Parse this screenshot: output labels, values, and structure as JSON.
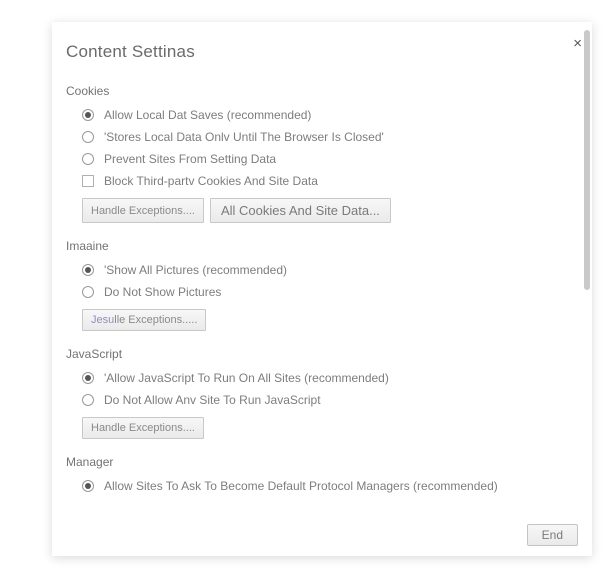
{
  "dialog": {
    "title": "Content Settinas",
    "close_glyph": "×",
    "end_label": "End"
  },
  "sections": {
    "cookies": {
      "label": "Cookies",
      "options": [
        "Allow Local Dat Saves (recommended)",
        "'Stores Local Data Onlv Until The Browser Is Closed'",
        "Prevent Sites From Setting Data",
        "Block Third-partv Cookies And Site Data"
      ],
      "selected": 0,
      "btn_handle": "Handle Exceptions....",
      "btn_all": "All Cookies And Site Data..."
    },
    "imagine": {
      "label": "Imaaine",
      "options": [
        "'Show All Pictures (recommended)",
        "Do Not Show Pictures"
      ],
      "selected": 0,
      "btn_prefix": "Jesu",
      "btn_rest": "lle Exceptions....."
    },
    "javascript": {
      "label": "JavaScript",
      "options": [
        "'Allow JavaScript To Run On All Sites (recommended)",
        "Do Not Allow Anv Site To Run JavaScript"
      ],
      "selected": 0,
      "btn_handle": "Handle Exceptions...."
    },
    "manager": {
      "label": "Manager",
      "options": [
        "Allow Sites To Ask To Become Default Protocol Managers (recommended)"
      ],
      "selected": 0
    }
  }
}
